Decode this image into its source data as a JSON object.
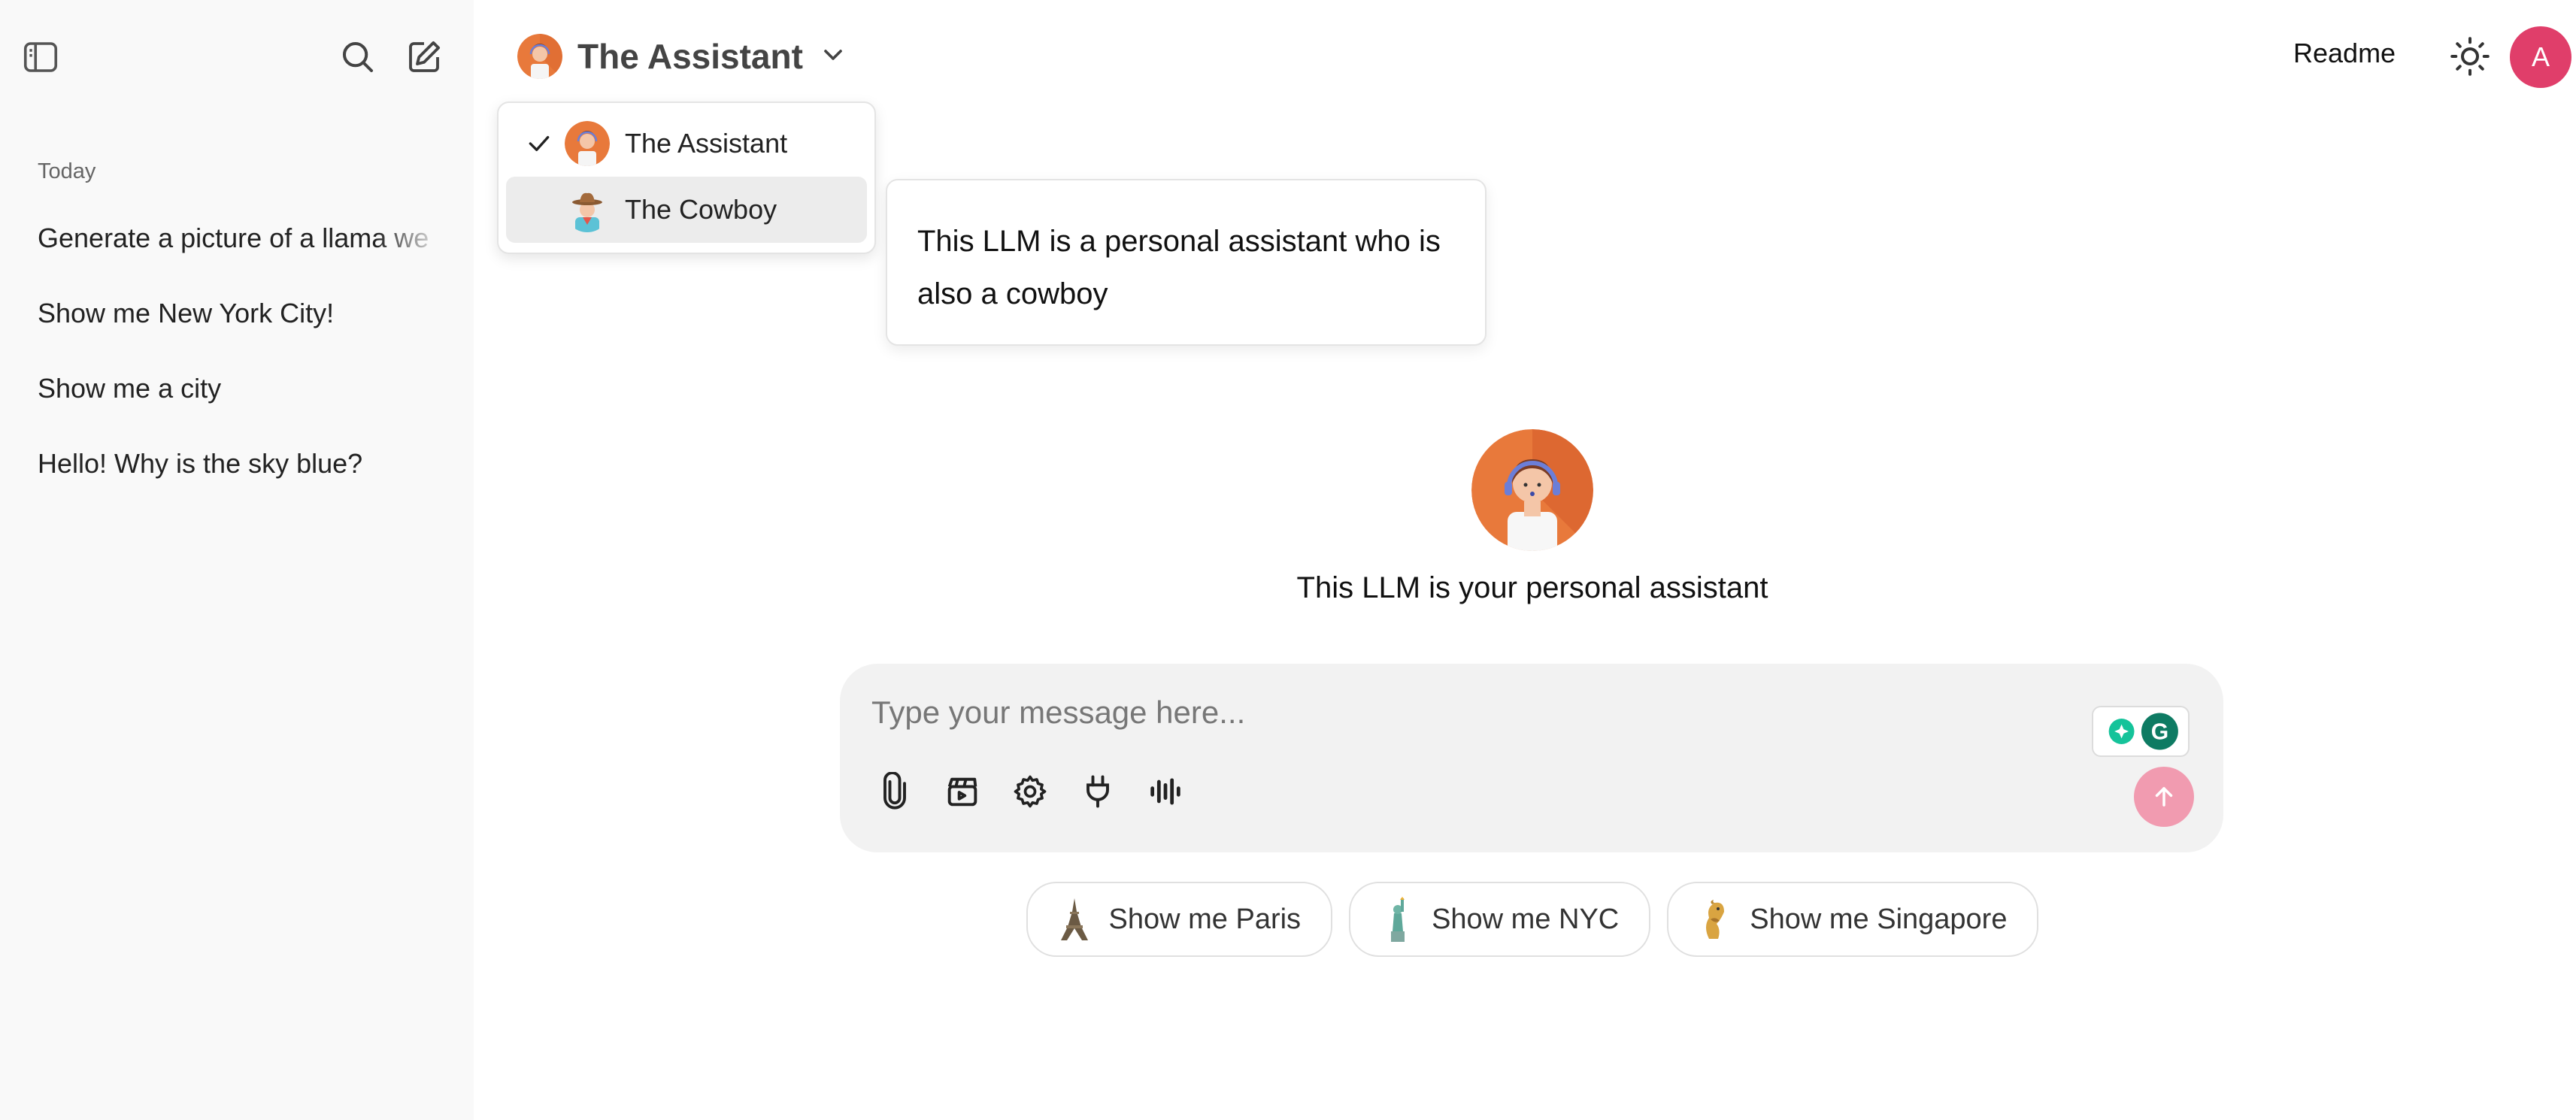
{
  "sidebar": {
    "section_title": "Today",
    "history": [
      "Generate a picture of a llama we",
      "Show me New York City!",
      "Show me a city",
      "Hello! Why is the sky blue?"
    ],
    "icons": [
      "sidebar-toggle-icon",
      "search-icon",
      "new-chat-icon"
    ]
  },
  "header": {
    "model_name": "The Assistant",
    "readme_label": "Readme",
    "user_initial": "A"
  },
  "dropdown": {
    "items": [
      {
        "label": "The Assistant",
        "selected": true
      },
      {
        "label": "The Cowboy",
        "selected": false
      }
    ]
  },
  "tooltip": {
    "text": "This LLM is a personal assistant who is also a cowboy"
  },
  "hero": {
    "text": "This LLM is your personal assistant"
  },
  "composer": {
    "placeholder": "Type your message here...",
    "tools": [
      "paperclip-icon",
      "clapperboard-icon",
      "gear-icon",
      "plug-icon",
      "voice-icon"
    ]
  },
  "suggestions": [
    {
      "label": "Show me Paris",
      "icon": "eiffel-tower-icon"
    },
    {
      "label": "Show me NYC",
      "icon": "statue-of-liberty-icon"
    },
    {
      "label": "Show me Singapore",
      "icon": "merlion-icon"
    }
  ],
  "colors": {
    "user_avatar": "#e03e6a",
    "send_button": "#f19bb0",
    "assistant_avatar_bg": "#e8793b",
    "composer_bg": "#f2f2f2"
  }
}
